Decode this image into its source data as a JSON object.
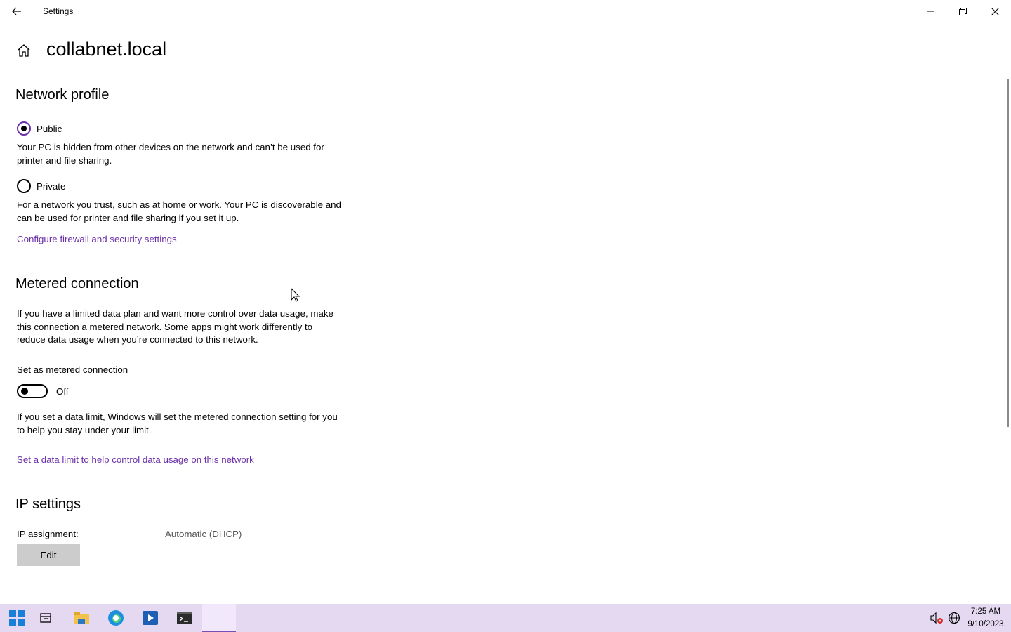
{
  "window": {
    "title": "Settings",
    "controls": [
      "minimize-icon",
      "restore-icon",
      "close-icon"
    ]
  },
  "header": {
    "title": "collabnet.local",
    "home_icon": "home-icon",
    "back_icon": "back-arrow-icon"
  },
  "network_profile": {
    "heading": "Network profile",
    "options": [
      {
        "label": "Public",
        "selected": true,
        "description": "Your PC is hidden from other devices on the network and can’t be used for printer and file sharing."
      },
      {
        "label": "Private",
        "selected": false,
        "description": "For a network you trust, such as at home or work. Your PC is discoverable and can be used for printer and file sharing if you set it up."
      }
    ],
    "link": "Configure firewall and security settings"
  },
  "metered": {
    "heading": "Metered connection",
    "description": "If you have a limited data plan and want more control over data usage, make this connection a metered network. Some apps might work differently to reduce data usage when you’re connected to this network.",
    "toggle_title": "Set as metered connection",
    "toggle_state": "Off",
    "toggle_on": false,
    "note": "If you set a data limit, Windows will set the metered connection setting for you to help you stay under your limit.",
    "link": "Set a data limit to help control data usage on this network"
  },
  "ip": {
    "heading": "IP settings",
    "assignment_label": "IP assignment:",
    "assignment_value": "Automatic (DHCP)",
    "edit_button": "Edit"
  },
  "taskbar": {
    "apps": [
      "windows-start-icon",
      "task-view-icon",
      "file-explorer-icon",
      "edge-icon",
      "media-app-icon",
      "terminal-icon",
      "settings-icon"
    ],
    "tray": [
      "speaker-muted-icon",
      "network-globe-icon"
    ],
    "time": "7:25 AM",
    "date": "9/10/2023"
  },
  "colors": {
    "accent": "#6b2fa8",
    "taskbar": "#e4d9f1",
    "button": "#cccccc"
  }
}
